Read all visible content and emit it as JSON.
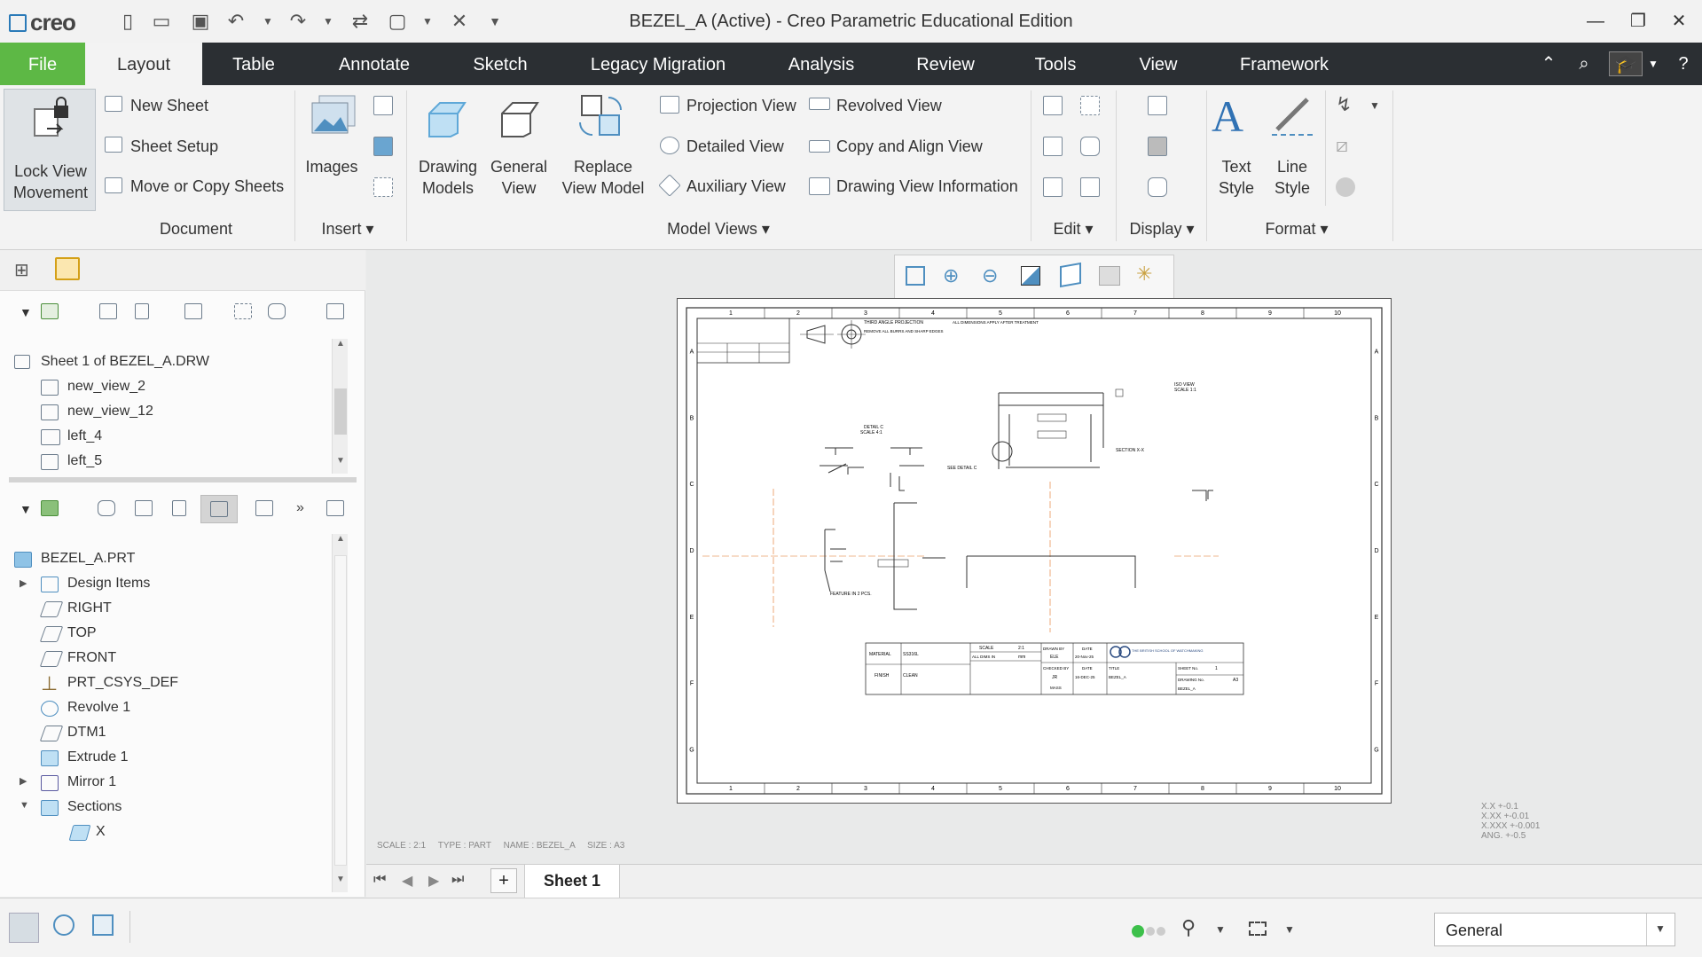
{
  "titlebar": {
    "logo": "creo",
    "title": "BEZEL_A (Active) - Creo Parametric Educational Edition"
  },
  "menu": {
    "file": "File",
    "tabs": [
      "Layout",
      "Table",
      "Annotate",
      "Sketch",
      "Legacy Migration",
      "Analysis",
      "Review",
      "Tools",
      "View",
      "Framework"
    ]
  },
  "ribbon": {
    "lock_view": [
      "Lock View",
      "Movement"
    ],
    "document": {
      "new_sheet": "New Sheet",
      "sheet_setup": "Sheet Setup",
      "move_copy": "Move or Copy Sheets",
      "group": "Document"
    },
    "insert": {
      "images": "Images",
      "group": "Insert"
    },
    "model_views": {
      "drawing_models": [
        "Drawing",
        "Models"
      ],
      "general_view": [
        "General",
        "View"
      ],
      "replace_view_model": [
        "Replace",
        "View Model"
      ],
      "projection_view": "Projection View",
      "detailed_view": "Detailed View",
      "auxiliary_view": "Auxiliary View",
      "revolved_view": "Revolved View",
      "copy_align_view": "Copy and Align View",
      "drawing_view_info": "Drawing View Information",
      "group": "Model Views"
    },
    "edit": {
      "group": "Edit"
    },
    "display": {
      "group": "Display"
    },
    "format": {
      "text_style": [
        "Text",
        "Style"
      ],
      "line_style": [
        "Line",
        "Style"
      ],
      "group": "Format"
    }
  },
  "drawing_tree": {
    "sheet": "Sheet 1 of BEZEL_A.DRW",
    "views": [
      "new_view_2",
      "new_view_12",
      "left_4",
      "left_5"
    ]
  },
  "model_tree": {
    "root": "BEZEL_A.PRT",
    "items": [
      "Design Items",
      "RIGHT",
      "TOP",
      "FRONT",
      "PRT_CSYS_DEF",
      "Revolve 1",
      "DTM1",
      "Extrude 1",
      "Mirror 1",
      "Sections",
      "X"
    ]
  },
  "canvas": {
    "info": "SCALE : 2:1     TYPE : PART     NAME : BEZEL_A     SIZE : A3",
    "tolerances": [
      "X.X  +-0.1",
      "X.XX  +-0.01",
      "X.XXX +-0.001",
      "ANG.  +-0.5"
    ],
    "sheet_cols": [
      "1",
      "2",
      "3",
      "4",
      "5",
      "6",
      "7",
      "8",
      "9",
      "10"
    ],
    "sheet_rows": [
      "A",
      "B",
      "C",
      "D",
      "E",
      "F",
      "G"
    ],
    "notes": {
      "iso_view": "ISO VIEW",
      "iso_scale": "SCALE 1:1",
      "detail_c": "DETAIL C",
      "detail_scale": "SCALE 4:1",
      "section": "SECTION X-X",
      "see_detail": "SEE DETAIL C",
      "feature": "FEATURE IN 2 PCS.",
      "projection": "THIRD ANGLE PROJECTION",
      "break_edges": "REMOVE ALL BURRS AND SHARP EDGES",
      "dims_apply": "ALL DIMENSIONS APPLY AFTER TREATMENT"
    },
    "titleblock": {
      "material_label": "MATERIAL",
      "material": "SS316L",
      "finish_label": "FINISH",
      "finish": "CLEAN",
      "scale_label": "SCALE",
      "scale": "2:1",
      "units_label": "ALL DIMS IN",
      "units": "mm",
      "drawn_by_label": "DRAWN BY",
      "drawn_by": "ELE",
      "date_label": "DATE",
      "date1": "20-Nov-25",
      "checked_label": "CHECKED BY",
      "checked": "JR",
      "date2": "16-DEC-25",
      "title_label": "TITLE",
      "title": "BEZEL_A",
      "sheet_label": "SHEET No.",
      "sheet_no": "1",
      "drawing_label": "DRAWING No.",
      "drawing_no": "BEZEL_A",
      "size": "A3",
      "mass_label": "MASS",
      "school": "THE BRITISH SCHOOL OF WATCHMAKING"
    }
  },
  "sheetbar": {
    "add": "+",
    "sheet": "Sheet 1"
  },
  "status": {
    "filter": "General"
  }
}
